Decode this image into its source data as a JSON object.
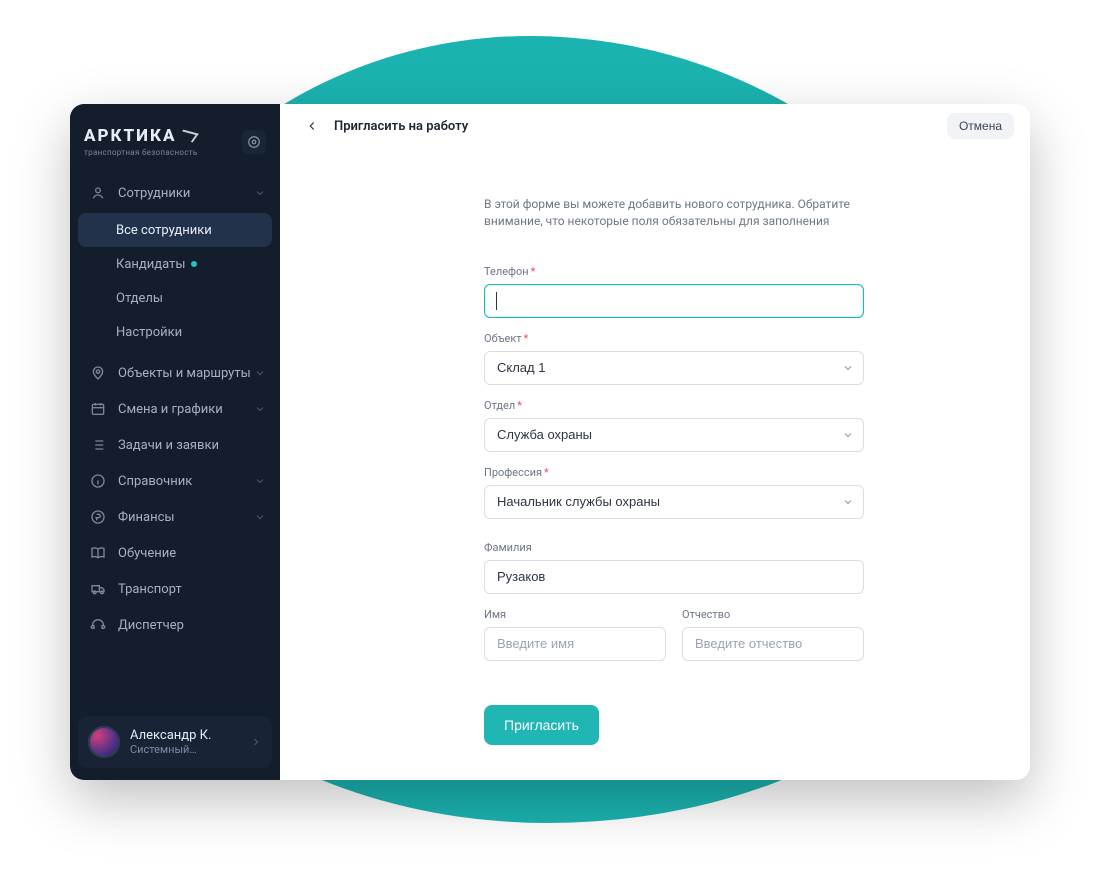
{
  "brand": {
    "name": "АРКТИКА",
    "tagline": "транспортная безопасность"
  },
  "sidebar": {
    "sections": [
      {
        "label": "Сотрудники",
        "expanded": true
      },
      {
        "label": "Объекты и маршруты"
      },
      {
        "label": "Смена и графики"
      },
      {
        "label": "Задачи и заявки"
      },
      {
        "label": "Справочник"
      },
      {
        "label": "Финансы"
      },
      {
        "label": "Обучение"
      },
      {
        "label": "Транспорт"
      },
      {
        "label": "Диспетчер"
      }
    ],
    "sub_employees": [
      {
        "label": "Все сотрудники",
        "active": true
      },
      {
        "label": "Кандидаты",
        "badge": true
      },
      {
        "label": "Отделы"
      },
      {
        "label": "Настройки"
      }
    ]
  },
  "user": {
    "name": "Александр К.",
    "role": "Системный…"
  },
  "topbar": {
    "title": "Пригласить на работу",
    "cancel": "Отмена"
  },
  "form": {
    "hint": "В этой форме вы можете добавить нового сотрудника. Обратите внимание, что некоторые поля обязательны для заполнения",
    "labels": {
      "phone": "Телефон",
      "object": "Объект",
      "department": "Отдел",
      "profession": "Профессия",
      "lastname": "Фамилия",
      "firstname": "Имя",
      "patronymic": "Отчество"
    },
    "values": {
      "phone": "",
      "object": "Склад 1",
      "department": "Служба охраны",
      "profession": "Начальник службы охраны",
      "lastname": "Рузаков",
      "firstname": "",
      "patronymic": ""
    },
    "placeholders": {
      "firstname": "Введите имя",
      "patronymic": "Введите отчество"
    },
    "submit_label": "Пригласить"
  }
}
